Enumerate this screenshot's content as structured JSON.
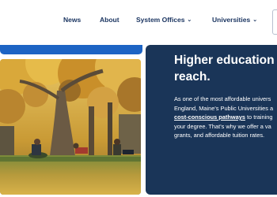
{
  "nav": {
    "items": [
      {
        "label": "News"
      },
      {
        "label": "About"
      },
      {
        "label": "System Offices",
        "chevron": "⌄"
      },
      {
        "label": "Universities",
        "chevron": "⌄"
      }
    ]
  },
  "hero": {
    "headline_line1": "Higher education th",
    "headline_line2": "reach.",
    "body_line1": "As one of the most affordable univers",
    "body_line2": "England, Maine's Public Universities a",
    "body_link": "cost-conscious pathways",
    "body_line3_after": " to training",
    "body_line4": "your degree. That's why we offer a va",
    "body_line5": "grants, and affordable tuition rates."
  },
  "colors": {
    "nav_text": "#1b3561",
    "panel_bg": "#1a3558",
    "accent_blue": "#1d64c4"
  },
  "photo": {
    "subject": "students studying under autumn trees on campus lawn"
  }
}
